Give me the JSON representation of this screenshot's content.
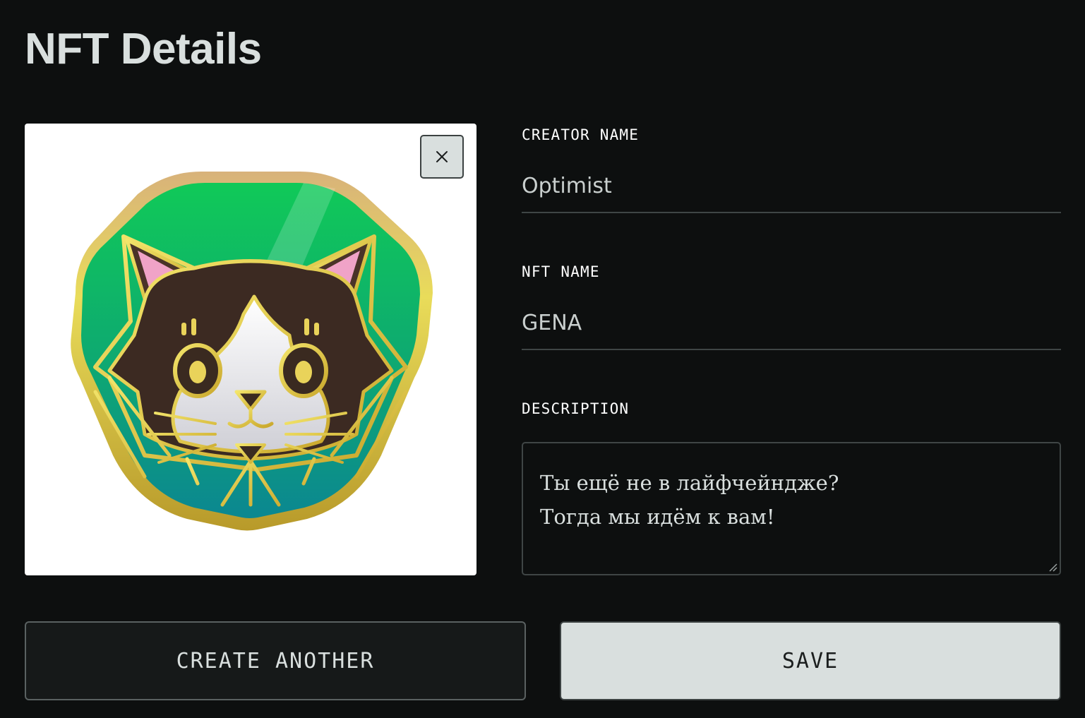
{
  "page": {
    "title": "NFT Details"
  },
  "image": {
    "subject": "cat-badge",
    "close_icon": "close-icon"
  },
  "form": {
    "creator_label": "CREATOR NAME",
    "creator_value": "Optimist",
    "nft_label": "NFT NAME",
    "nft_value": "GENA",
    "description_label": "DESCRIPTION",
    "description_lines": [
      "Ты ещё не в лайфчейндже?",
      "Тогда мы идём к вам!"
    ]
  },
  "actions": {
    "create_another_label": "CREATE ANOTHER",
    "save_label": "SAVE"
  },
  "colors": {
    "background": "#0d0f0f",
    "text": "#d9dfde",
    "primary_button": "#d9dfde",
    "badge_green": "#22c55e",
    "badge_teal": "#0e8a86",
    "badge_gold": "#d9c34a"
  }
}
